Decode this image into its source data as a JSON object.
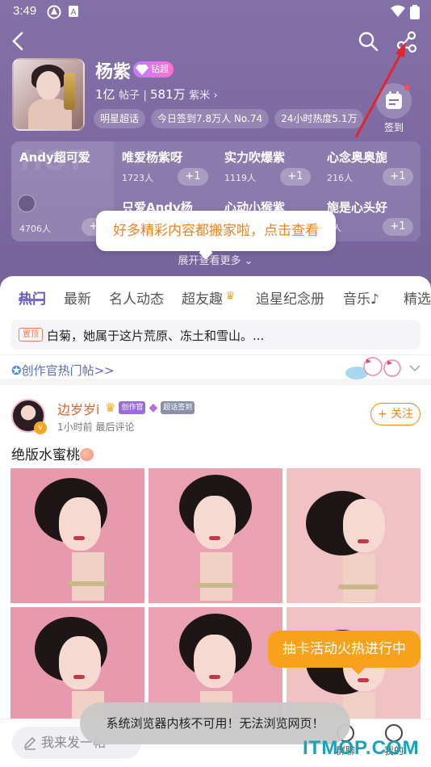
{
  "status_bar": {
    "time": "3:49"
  },
  "header": {
    "name": "杨紫",
    "vip_badge": "钻超",
    "posts_count": "1亿",
    "posts_label": "帖子",
    "fans_count": "581万",
    "fans_label": "紫米",
    "chips": [
      "明星超话",
      "今日签到7.8万人 No.74",
      "24小时热度5.1万"
    ],
    "signin_label": "签到"
  },
  "groups": [
    {
      "title": "Andy超可爱",
      "count": "4706人",
      "plus": "+"
    },
    {
      "title": "唯爱杨紫呀",
      "count": "1723人",
      "plus": "+1"
    },
    {
      "title": "实力吹爆紫",
      "count": "1119人",
      "plus": "+1"
    },
    {
      "title": "心念奥奥旎",
      "count": "216人",
      "plus": "+1"
    },
    {
      "title": "只爱Andy杨",
      "count": "",
      "plus": ""
    },
    {
      "title": "心动小猴紫",
      "count": "",
      "plus": ""
    },
    {
      "title": "旎是心头好",
      "count": "0人",
      "plus": "+1"
    }
  ],
  "hot_watermark": "HOT",
  "tooltip": "好多精彩内容都搬家啦，点击查看",
  "expand_more": "展开查看更多",
  "tabs": [
    "热门",
    "最新",
    "名人动态",
    "超友趣",
    "追星纪念册",
    "音乐♪",
    "精选"
  ],
  "pinned": {
    "badge": "置顶",
    "text": "白菊，她属于这片荒原、冻土和雪山。..."
  },
  "creator_link": "创作官热门帖>>",
  "post": {
    "author": "边岁岁i",
    "badges": [
      "创作官",
      "超话签到"
    ],
    "avatar_badge": "v",
    "meta": "1小时前 最后评论",
    "follow": "+ 关注",
    "title": "绝版水蜜桃"
  },
  "lucky_banner": "抽卡活动火热进行中",
  "bottom": {
    "compose_placeholder": "我来发一帖",
    "nav": [
      "群聊",
      "我的"
    ]
  },
  "toast": "系统浏览器内核不可用！无法浏览网页！",
  "watermark": "ITMOP.COM",
  "colors": {
    "hero": "#7c69a2",
    "accent": "#6a57b7",
    "orange": "#f08321",
    "follow": "#f08321"
  }
}
